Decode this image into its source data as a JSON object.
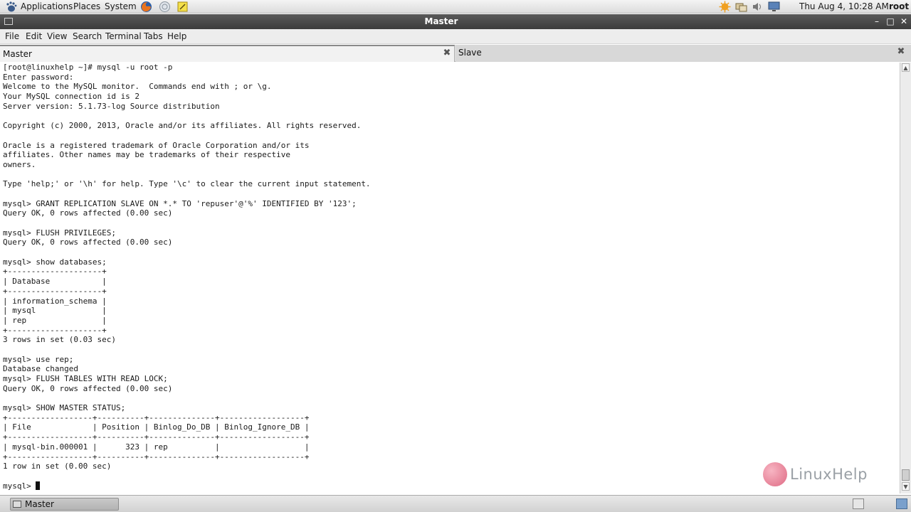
{
  "top_panel": {
    "menus": [
      "Applications",
      "Places",
      "System"
    ],
    "launchers": [
      "firefox-icon",
      "network-icon",
      "text-editor-icon"
    ],
    "tray": [
      "update-icon",
      "network-tray-icon",
      "volume-icon",
      "display-icon"
    ],
    "clock": "Thu Aug  4, 10:28 AM",
    "user": "root"
  },
  "window": {
    "title": "Master"
  },
  "menubar": {
    "items": [
      "File",
      "Edit",
      "View",
      "Search",
      "Terminal",
      "Tabs",
      "Help"
    ]
  },
  "tabs": [
    {
      "label": "Master",
      "active": true
    },
    {
      "label": "Slave",
      "active": false
    }
  ],
  "terminal": {
    "lines": [
      "[root@linuxhelp ~]# mysql -u root -p",
      "Enter password:",
      "Welcome to the MySQL monitor.  Commands end with ; or \\g.",
      "Your MySQL connection id is 2",
      "Server version: 5.1.73-log Source distribution",
      "",
      "Copyright (c) 2000, 2013, Oracle and/or its affiliates. All rights reserved.",
      "",
      "Oracle is a registered trademark of Oracle Corporation and/or its",
      "affiliates. Other names may be trademarks of their respective",
      "owners.",
      "",
      "Type 'help;' or '\\h' for help. Type '\\c' to clear the current input statement.",
      "",
      "mysql> GRANT REPLICATION SLAVE ON *.* TO 'repuser'@'%' IDENTIFIED BY '123';",
      "Query OK, 0 rows affected (0.00 sec)",
      "",
      "mysql> FLUSH PRIVILEGES;",
      "Query OK, 0 rows affected (0.00 sec)",
      "",
      "mysql> show databases;",
      "+--------------------+",
      "| Database           |",
      "+--------------------+",
      "| information_schema |",
      "| mysql              |",
      "| rep                |",
      "+--------------------+",
      "3 rows in set (0.03 sec)",
      "",
      "mysql> use rep;",
      "Database changed",
      "mysql> FLUSH TABLES WITH READ LOCK;",
      "Query OK, 0 rows affected (0.00 sec)",
      "",
      "mysql> SHOW MASTER STATUS;",
      "+------------------+----------+--------------+------------------+",
      "| File             | Position | Binlog_Do_DB | Binlog_Ignore_DB |",
      "+------------------+----------+--------------+------------------+",
      "| mysql-bin.000001 |      323 | rep          |                  |",
      "+------------------+----------+--------------+------------------+",
      "1 row in set (0.00 sec)",
      ""
    ],
    "prompt": "mysql> "
  },
  "watermark": {
    "text": "LinuxHelp"
  },
  "taskbar": {
    "task_label": "Master"
  }
}
